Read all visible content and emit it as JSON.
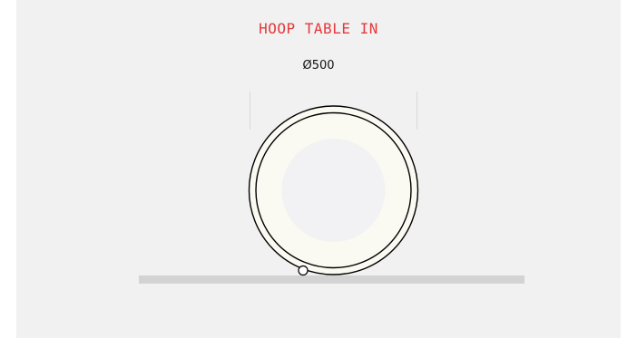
{
  "header": {
    "title": "HOOP TABLE IN",
    "dimension_label": "Ø500"
  },
  "colors": {
    "background": "#f1f1f1",
    "title": "#e5393b",
    "hoop_fill": "#fafaf2",
    "inner_disc": "#f2f2f4",
    "floor": "#d3d3d3",
    "outline": "#000000",
    "dimension_line": "#d8d8d8"
  }
}
